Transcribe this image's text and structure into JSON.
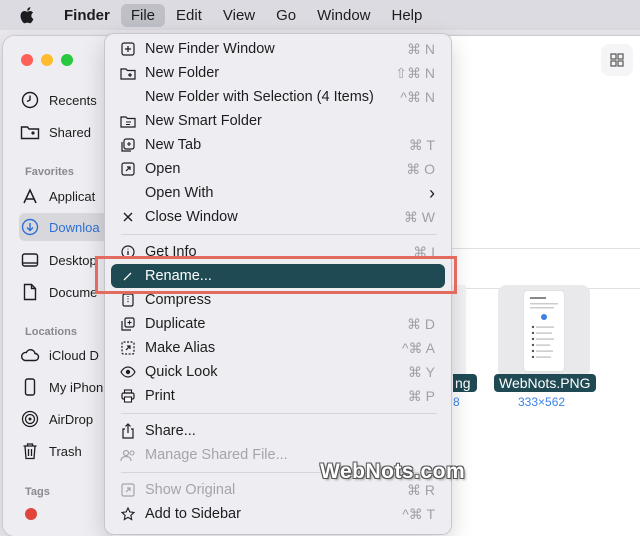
{
  "menubar": {
    "app": "Finder",
    "items": [
      "File",
      "Edit",
      "View",
      "Go",
      "Window",
      "Help"
    ]
  },
  "sidebar": {
    "top_items": [
      {
        "label": "Recents",
        "icon": "clock-icon"
      },
      {
        "label": "Shared",
        "icon": "shared-folder-icon"
      }
    ],
    "favorites_heading": "Favorites",
    "favorites": [
      {
        "label": "Applicat",
        "icon": "applications-icon"
      },
      {
        "label": "Downloa",
        "icon": "downloads-icon"
      },
      {
        "label": "Desktop",
        "icon": "desktop-icon"
      },
      {
        "label": "Docume",
        "icon": "document-icon"
      }
    ],
    "locations_heading": "Locations",
    "locations": [
      {
        "label": "iCloud D",
        "icon": "cloud-icon"
      },
      {
        "label": "My iPhon",
        "icon": "iphone-icon"
      },
      {
        "label": "AirDrop",
        "icon": "airdrop-icon"
      },
      {
        "label": "Trash",
        "icon": "trash-icon"
      }
    ],
    "tags_heading": "Tags"
  },
  "files": {
    "partial_name": "ng",
    "partial_sub": "8",
    "name": "WebNots.PNG",
    "dimensions": "333×562"
  },
  "file_menu": {
    "items": [
      {
        "label": "New Finder Window",
        "shortcut": "⌘ N",
        "icon": "new-window-icon"
      },
      {
        "label": "New Folder",
        "shortcut": "⇧⌘ N",
        "icon": "new-folder-icon"
      },
      {
        "label": "New Folder with Selection (4 Items)",
        "shortcut": "^⌘ N",
        "icon": ""
      },
      {
        "label": "New Smart Folder",
        "shortcut": "",
        "icon": "smart-folder-icon"
      },
      {
        "label": "New Tab",
        "shortcut": "⌘ T",
        "icon": "new-tab-icon"
      },
      {
        "label": "Open",
        "shortcut": "⌘ O",
        "icon": "open-icon"
      },
      {
        "label": "Open With",
        "shortcut": "›",
        "icon": ""
      },
      {
        "label": "Close Window",
        "shortcut": "⌘ W",
        "icon": "close-icon"
      },
      {
        "label": "Get Info",
        "shortcut": "⌘ I",
        "icon": "info-icon"
      },
      {
        "label": "Rename...",
        "shortcut": "",
        "icon": "pencil-icon"
      },
      {
        "label": "Compress",
        "shortcut": "",
        "icon": "compress-icon"
      },
      {
        "label": "Duplicate",
        "shortcut": "⌘ D",
        "icon": "duplicate-icon"
      },
      {
        "label": "Make Alias",
        "shortcut": "^⌘ A",
        "icon": "alias-icon"
      },
      {
        "label": "Quick Look",
        "shortcut": "⌘ Y",
        "icon": "eye-icon"
      },
      {
        "label": "Print",
        "shortcut": "⌘ P",
        "icon": "printer-icon"
      },
      {
        "label": "Share...",
        "shortcut": "",
        "icon": "share-icon"
      },
      {
        "label": "Manage Shared File...",
        "shortcut": "",
        "icon": "manage-share-icon"
      },
      {
        "label": "Show Original",
        "shortcut": "⌘ R",
        "icon": "show-original-icon"
      },
      {
        "label": "Add to Sidebar",
        "shortcut": "^⌘ T",
        "icon": "star-icon"
      }
    ]
  },
  "watermark": "WebNots.com",
  "colors": {
    "highlight": "#1f4a54",
    "callout_border": "#e26a5f",
    "selected_sidebar_text": "#2e6fd6"
  }
}
